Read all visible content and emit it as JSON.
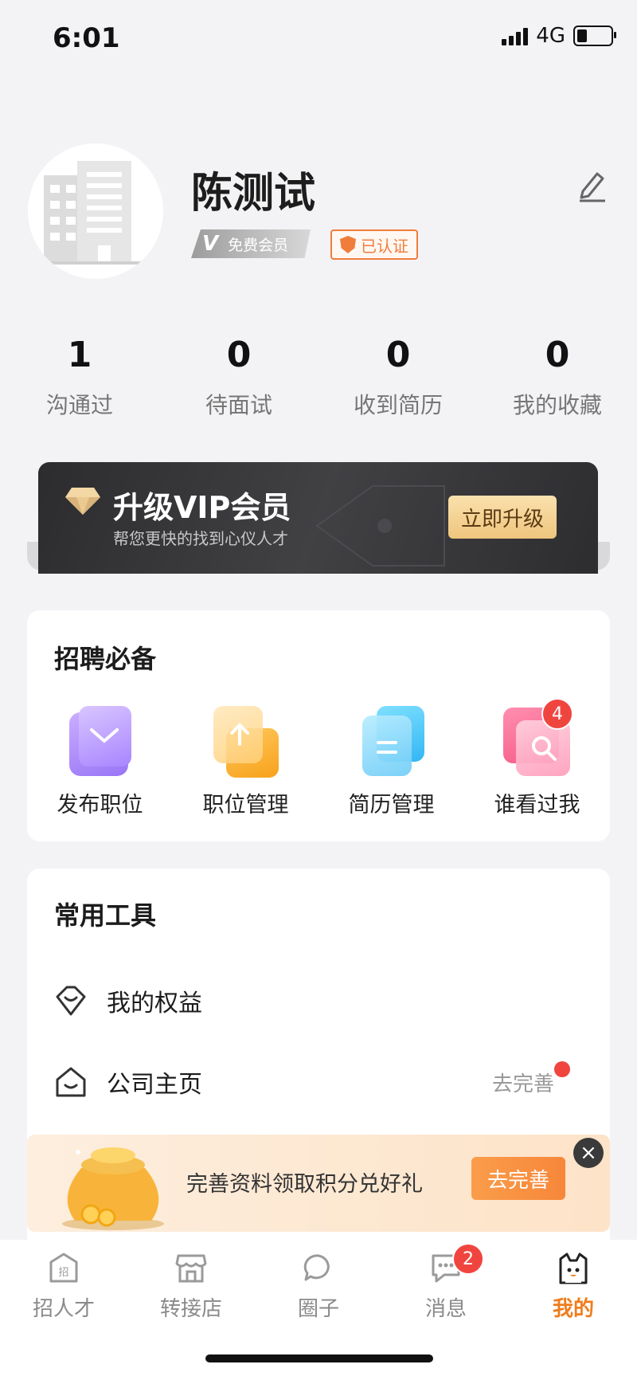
{
  "status": {
    "time": "6:01",
    "network": "4G"
  },
  "profile": {
    "name": "陈测试",
    "member_badge": "免费会员",
    "member_badge_letter": "V",
    "verified_badge": "已认证"
  },
  "stats": [
    {
      "value": "1",
      "label": "沟通过"
    },
    {
      "value": "0",
      "label": "待面试"
    },
    {
      "value": "0",
      "label": "收到简历"
    },
    {
      "value": "0",
      "label": "我的收藏"
    }
  ],
  "vip": {
    "title": "升级VIP会员",
    "subtitle": "帮您更快的找到心仪人才",
    "button": "立即升级"
  },
  "recruit": {
    "title": "招聘必备",
    "items": [
      {
        "label": "发布职位",
        "icon": "post-job-icon"
      },
      {
        "label": "职位管理",
        "icon": "job-manage-icon"
      },
      {
        "label": "简历管理",
        "icon": "resume-manage-icon"
      },
      {
        "label": "谁看过我",
        "icon": "viewed-me-icon",
        "badge": "4"
      }
    ]
  },
  "tools": {
    "title": "常用工具",
    "items": [
      {
        "label": "我的权益",
        "icon": "benefits-icon"
      },
      {
        "label": "公司主页",
        "icon": "company-home-icon",
        "action": "去完善"
      }
    ]
  },
  "banner": {
    "text": "完善资料领取积分兑好礼",
    "button": "去完善"
  },
  "nav": [
    {
      "label": "招人才",
      "icon": "recruit-icon"
    },
    {
      "label": "转接店",
      "icon": "shop-icon"
    },
    {
      "label": "圈子",
      "icon": "circle-icon"
    },
    {
      "label": "消息",
      "icon": "message-icon",
      "badge": "2"
    },
    {
      "label": "我的",
      "icon": "mine-icon",
      "active": true
    }
  ],
  "colors": {
    "accent": "#f07d1c",
    "badge_red": "#f0453f",
    "background": "#f3f3f6"
  }
}
